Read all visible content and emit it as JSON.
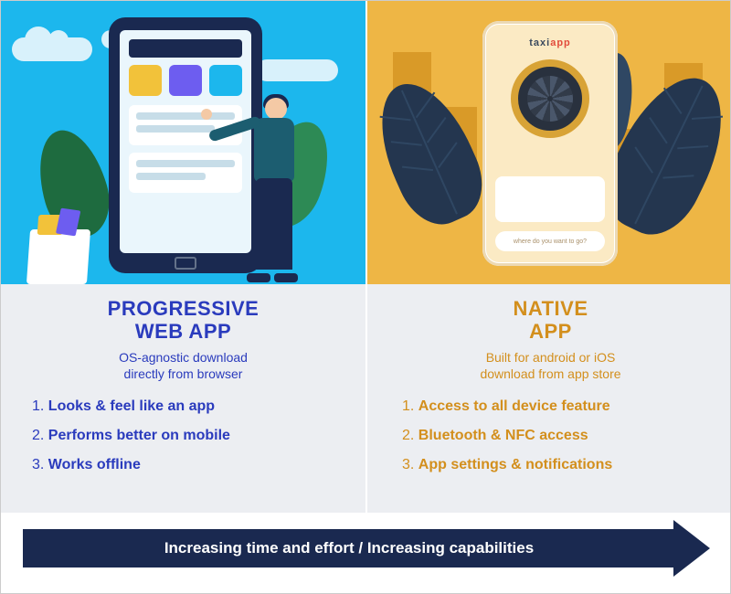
{
  "left": {
    "title_line1": "PROGRESSIVE",
    "title_line2": "WEB APP",
    "subtitle_line1": "OS-agnostic download",
    "subtitle_line2": "directly from browser",
    "features": [
      "Looks & feel like an app",
      "Performs better on mobile",
      "Works offline"
    ]
  },
  "right": {
    "title_line1": "NATIVE",
    "title_line2": "APP",
    "subtitle_line1": "Built for android or iOS",
    "subtitle_line2": "download from app store",
    "features": [
      "Access to all device feature",
      "Bluetooth & NFC access",
      "App settings & notifications"
    ],
    "mock_app_name_a": "taxi",
    "mock_app_name_b": "app",
    "mock_prompt": "where do you want to go?"
  },
  "arrow_label": "Increasing time and effort / Increasing capabilities",
  "colors": {
    "blue": "#2a3bbd",
    "gold": "#d38f1d",
    "navy": "#1a2950",
    "sky": "#1cb7ed",
    "mustard": "#eeb645"
  }
}
